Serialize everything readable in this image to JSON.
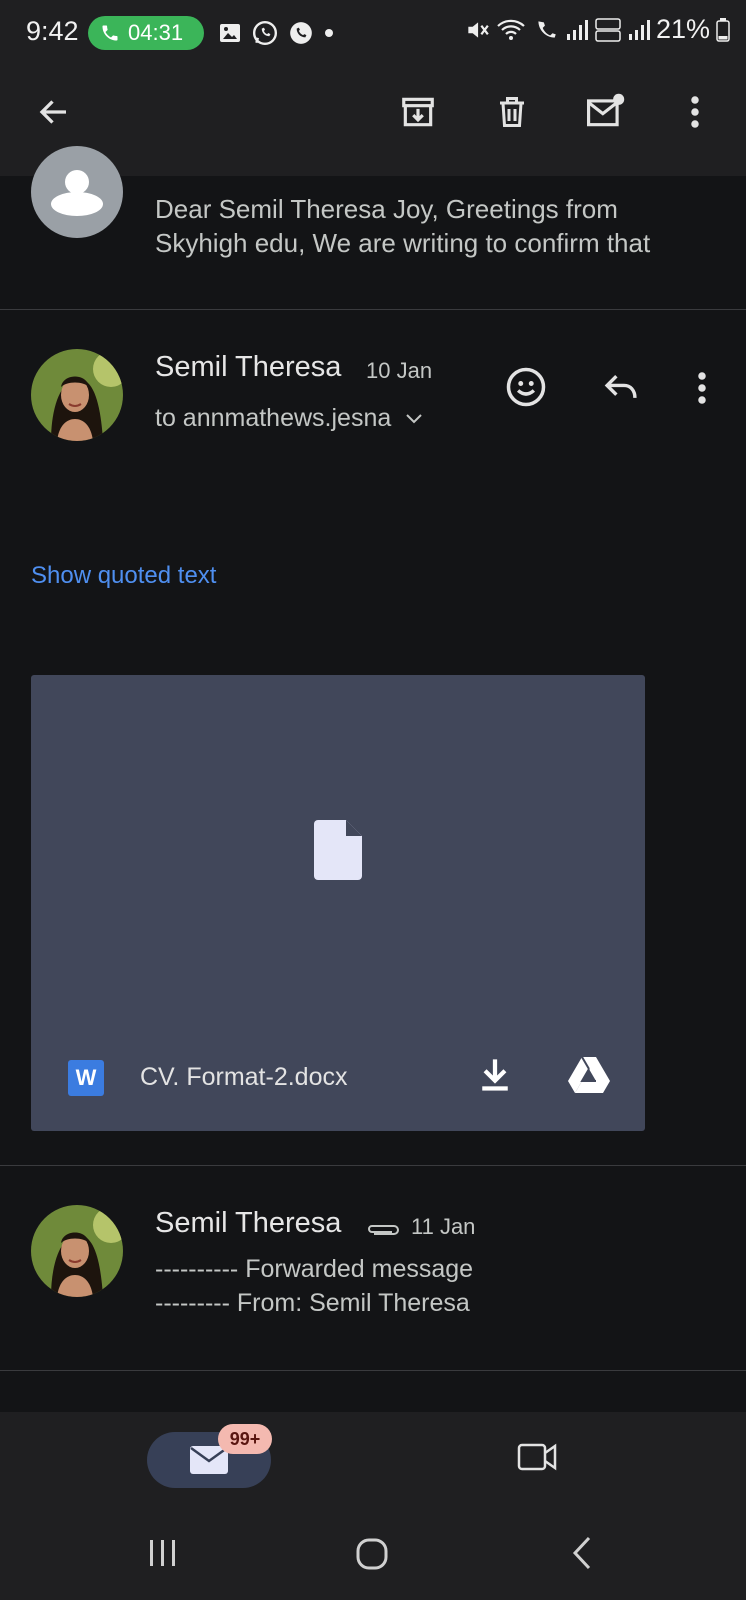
{
  "status_bar": {
    "time": "9:42",
    "call_duration": "04:31",
    "battery": "21%"
  },
  "top_bar": {
    "icons": [
      "back-arrow-icon",
      "archive-icon",
      "delete-icon",
      "mark-unread-icon",
      "more-vert-icon"
    ]
  },
  "preview": {
    "text": "Dear Semil Theresa Joy, Greetings from Skyhigh edu, We are writing to confirm that"
  },
  "message1": {
    "sender": "Semil Theresa",
    "date": "10 Jan",
    "to": "to annmathews.jesna",
    "show_quoted": "Show quoted text",
    "attachment": {
      "file_type_badge": "W",
      "filename": "CV.  Format-2.docx"
    }
  },
  "message2": {
    "sender": "Semil Theresa",
    "date": "11 Jan",
    "snippet_line1": "---------- Forwarded message",
    "snippet_line2": "--------- From: Semil Theresa"
  },
  "bottom_nav": {
    "mail_badge": "99+"
  },
  "colors": {
    "background": "#131416",
    "bar": "#1f1f21",
    "link": "#4f8ff0",
    "attachment_bg": "#41475a",
    "call_green": "#3bb559",
    "badge_bg": "#f4b9b0"
  }
}
